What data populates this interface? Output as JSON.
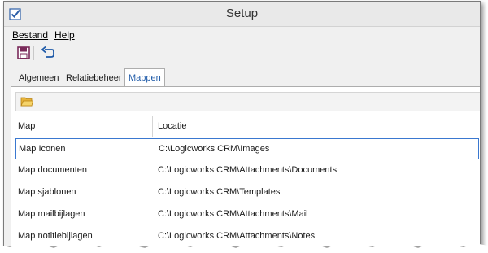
{
  "window": {
    "title": "Setup"
  },
  "menu": {
    "items": [
      "Bestand",
      "Help"
    ]
  },
  "toolbar": {
    "save_icon": "save-icon",
    "undo_icon": "undo-icon"
  },
  "tabs": [
    {
      "label": "Algemeen",
      "active": false
    },
    {
      "label": "Relatiebeheer",
      "active": false
    },
    {
      "label": "Mappen",
      "active": true
    }
  ],
  "panel_toolbar": {
    "icon": "folder-open-icon"
  },
  "grid": {
    "columns": [
      "Map",
      "Locatie"
    ],
    "rows": [
      {
        "map": "Map Iconen",
        "locatie": "C:\\Logicworks CRM\\Images",
        "selected": true
      },
      {
        "map": "Map documenten",
        "locatie": "C:\\Logicworks CRM\\Attachments\\Documents",
        "selected": false
      },
      {
        "map": "Map sjablonen",
        "locatie": "C:\\Logicworks CRM\\Templates",
        "selected": false
      },
      {
        "map": "Map mailbijlagen",
        "locatie": "C:\\Logicworks CRM\\Attachments\\Mail",
        "selected": false
      },
      {
        "map": "Map notitiebijlagen",
        "locatie": "C:\\Logicworks CRM\\Attachments\\Notes",
        "selected": false
      }
    ]
  },
  "colors": {
    "accent": "#1e5aa8",
    "selection_border": "#3a78d0",
    "save_icon": "#7a2a5a"
  }
}
